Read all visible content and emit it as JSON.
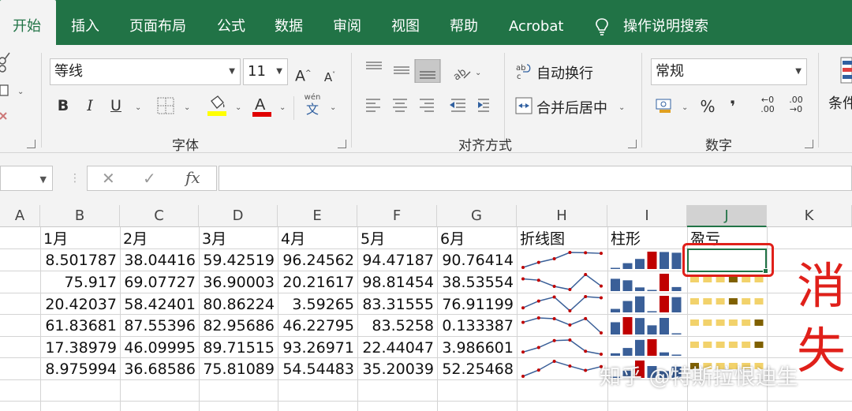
{
  "tabs": [
    "开始",
    "插入",
    "页面布局",
    "公式",
    "数据",
    "审阅",
    "视图",
    "帮助",
    "Acrobat",
    "操作说明搜索"
  ],
  "ribbon": {
    "font_name": "等线",
    "font_size": "11",
    "grow_font": "A",
    "shrink_font": "A",
    "bold": "B",
    "italic": "I",
    "underline": "U",
    "phonetic_top": "wén",
    "phonetic_bottom": "文",
    "font_group": "字体",
    "wrap_text": "自动换行",
    "merge_center": "合并后居中",
    "align_group": "对齐方式",
    "number_format": "常规",
    "percent": "%",
    "comma": "❜",
    "inc_decimal_top": "←0",
    "inc_decimal_bottom": ".00",
    "dec_decimal_top": ".00",
    "dec_decimal_bottom": "→0",
    "number_group": "数字",
    "conditional": "条件"
  },
  "formula": {
    "cancel": "✕",
    "enter": "✓",
    "fx": "fx",
    "content": ""
  },
  "columns": [
    "A",
    "B",
    "C",
    "D",
    "E",
    "F",
    "G",
    "H",
    "I",
    "J",
    "K"
  ],
  "header_row": [
    "1月",
    "2月",
    "3月",
    "4月",
    "5月",
    "6月",
    "折线图",
    "柱形",
    "盈亏"
  ],
  "rows": [
    [
      "8.501787",
      "38.04416",
      "59.42519",
      "96.24562",
      "94.47187",
      "90.76414"
    ],
    [
      "75.917",
      "69.07727",
      "36.90003",
      "20.21617",
      "98.81454",
      "38.53554"
    ],
    [
      "20.42037",
      "58.42401",
      "80.86224",
      "3.59265",
      "83.31555",
      "76.91199"
    ],
    [
      "61.83681",
      "87.55396",
      "82.95686",
      "46.22795",
      "83.5258",
      "0.133387"
    ],
    [
      "17.38979",
      "46.09995",
      "89.71515",
      "93.26971",
      "22.44047",
      "3.986601"
    ],
    [
      "8.975994",
      "36.68586",
      "75.81089",
      "54.54483",
      "35.20039",
      "52.25468"
    ]
  ],
  "annotation": [
    "消",
    "失"
  ],
  "watermark": "知乎 @特斯拉恨迪生",
  "colors": {
    "excel_green": "#217346",
    "bar_blue": "#3a5f98",
    "bar_red": "#c00000",
    "wl_light": "#f2d26b",
    "wl_dark": "#7f6000",
    "line_blue": "#3a5f98",
    "marker_red": "#c00000",
    "annotation_red": "#e0201a"
  }
}
